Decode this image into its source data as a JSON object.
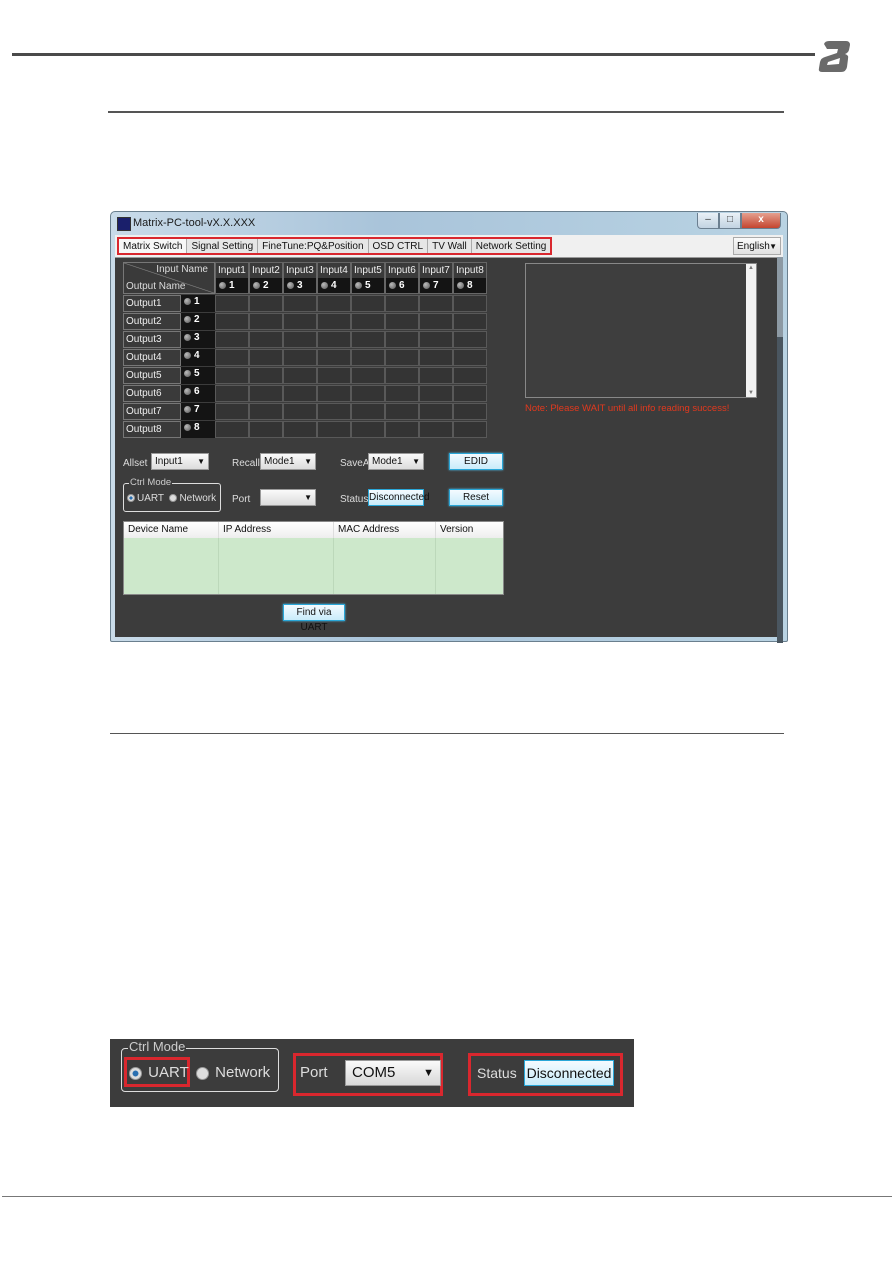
{
  "window": {
    "title": "Matrix-PC-tool-vX.X.XXX",
    "controls": {
      "minimize": "–",
      "maximize": "□",
      "close": "x"
    }
  },
  "tabs": [
    {
      "label": "Matrix Switch",
      "active": true
    },
    {
      "label": "Signal Setting",
      "active": false
    },
    {
      "label": "FineTune:PQ&Position",
      "active": false
    },
    {
      "label": "OSD CTRL",
      "active": false
    },
    {
      "label": "TV Wall",
      "active": false
    },
    {
      "label": "Network Setting",
      "active": false
    }
  ],
  "language": {
    "selected": "English"
  },
  "matrix": {
    "corner_input_label": "Input Name",
    "corner_output_label": "Output Name",
    "inputs": [
      {
        "name": "Input1",
        "num": "1"
      },
      {
        "name": "Input2",
        "num": "2"
      },
      {
        "name": "Input3",
        "num": "3"
      },
      {
        "name": "Input4",
        "num": "4"
      },
      {
        "name": "Input5",
        "num": "5"
      },
      {
        "name": "Input6",
        "num": "6"
      },
      {
        "name": "Input7",
        "num": "7"
      },
      {
        "name": "Input8",
        "num": "8"
      }
    ],
    "outputs": [
      {
        "name": "Output1",
        "num": "1"
      },
      {
        "name": "Output2",
        "num": "2"
      },
      {
        "name": "Output3",
        "num": "3"
      },
      {
        "name": "Output4",
        "num": "4"
      },
      {
        "name": "Output5",
        "num": "5"
      },
      {
        "name": "Output6",
        "num": "6"
      },
      {
        "name": "Output7",
        "num": "7"
      },
      {
        "name": "Output8",
        "num": "8"
      }
    ]
  },
  "log": {
    "note": "Note: Please WAIT until all info reading success!"
  },
  "controls": {
    "allset_label": "Allset",
    "allset_value": "Input1",
    "recall_label": "Recall",
    "recall_value": "Mode1",
    "saveas_label": "SaveAs",
    "saveas_value": "Mode1",
    "edid_button": "EDID",
    "ctrl_mode_label": "Ctrl Mode",
    "uart_label": "UART",
    "network_label": "Network",
    "ctrl_mode_selected": "UART",
    "port_label": "Port",
    "port_value": "",
    "status_label": "Status",
    "status_value": "Disconnected",
    "reset_button": "Reset"
  },
  "device_table": {
    "columns": [
      "Device Name",
      "IP Address",
      "MAC Address",
      "Version"
    ],
    "rows": []
  },
  "find_button": "Find via UART",
  "detail_strip": {
    "ctrl_mode_label": "Ctrl Mode",
    "uart_label": "UART",
    "network_label": "Network",
    "port_label": "Port",
    "port_value": "COM5",
    "status_label": "Status",
    "status_value": "Disconnected"
  },
  "colors": {
    "highlight_red": "#d9272e",
    "note_red": "#e2391e",
    "app_bg": "#3c3c3c",
    "button_blue": "#2aa7d8",
    "table_green": "#cde8cb"
  }
}
